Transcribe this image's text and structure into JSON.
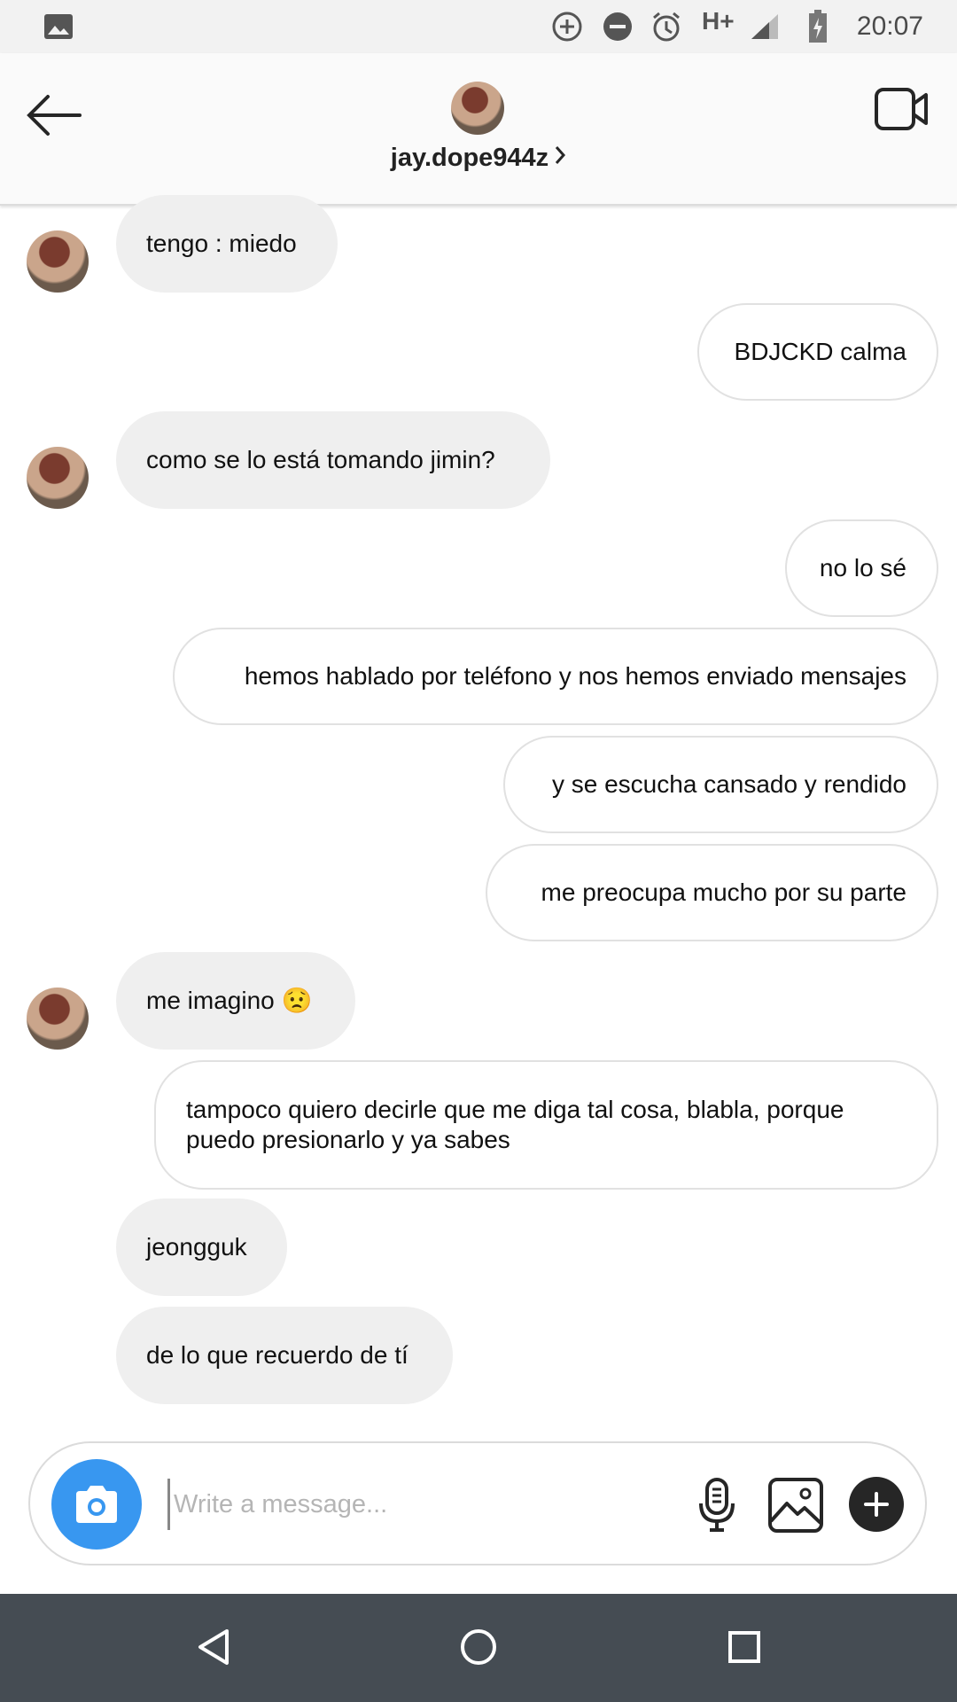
{
  "status_bar": {
    "time": "20:07",
    "network": "H+",
    "icons": [
      "image-icon",
      "data-saver-icon",
      "do-not-disturb-icon",
      "alarm-icon",
      "signal-icon",
      "battery-charging-icon"
    ]
  },
  "header": {
    "username": "jay.dope944z",
    "back_icon": "arrow-left-icon",
    "video_icon": "video-call-icon"
  },
  "messages": [
    {
      "side": "in",
      "text": "tengo : miedo",
      "avatar": true
    },
    {
      "side": "out",
      "text": "BDJCKD calma"
    },
    {
      "side": "in",
      "text": "como se lo está tomando jimin?",
      "avatar": true
    },
    {
      "side": "out",
      "text": "no lo sé"
    },
    {
      "side": "out",
      "text": "hemos hablado por teléfono y nos hemos enviado mensajes"
    },
    {
      "side": "out",
      "text": "y se escucha cansado y rendido"
    },
    {
      "side": "out",
      "text": "me preocupa mucho por su parte"
    },
    {
      "side": "in",
      "text": "me imagino 😟",
      "avatar": true
    },
    {
      "side": "out",
      "text": "tampoco quiero decirle que me diga tal cosa, blabla, porque puedo presionarlo y ya sabes"
    },
    {
      "side": "in",
      "text": "jeongguk"
    },
    {
      "side": "in",
      "text": "de lo que recuerdo de tí"
    }
  ],
  "composer": {
    "placeholder": "Write a message...",
    "camera_icon": "camera-icon",
    "mic_icon": "microphone-icon",
    "gallery_icon": "gallery-icon",
    "plus_icon": "plus-icon"
  },
  "nav_bar": {
    "icons": [
      "back-triangle-icon",
      "home-circle-icon",
      "recents-square-icon"
    ]
  }
}
